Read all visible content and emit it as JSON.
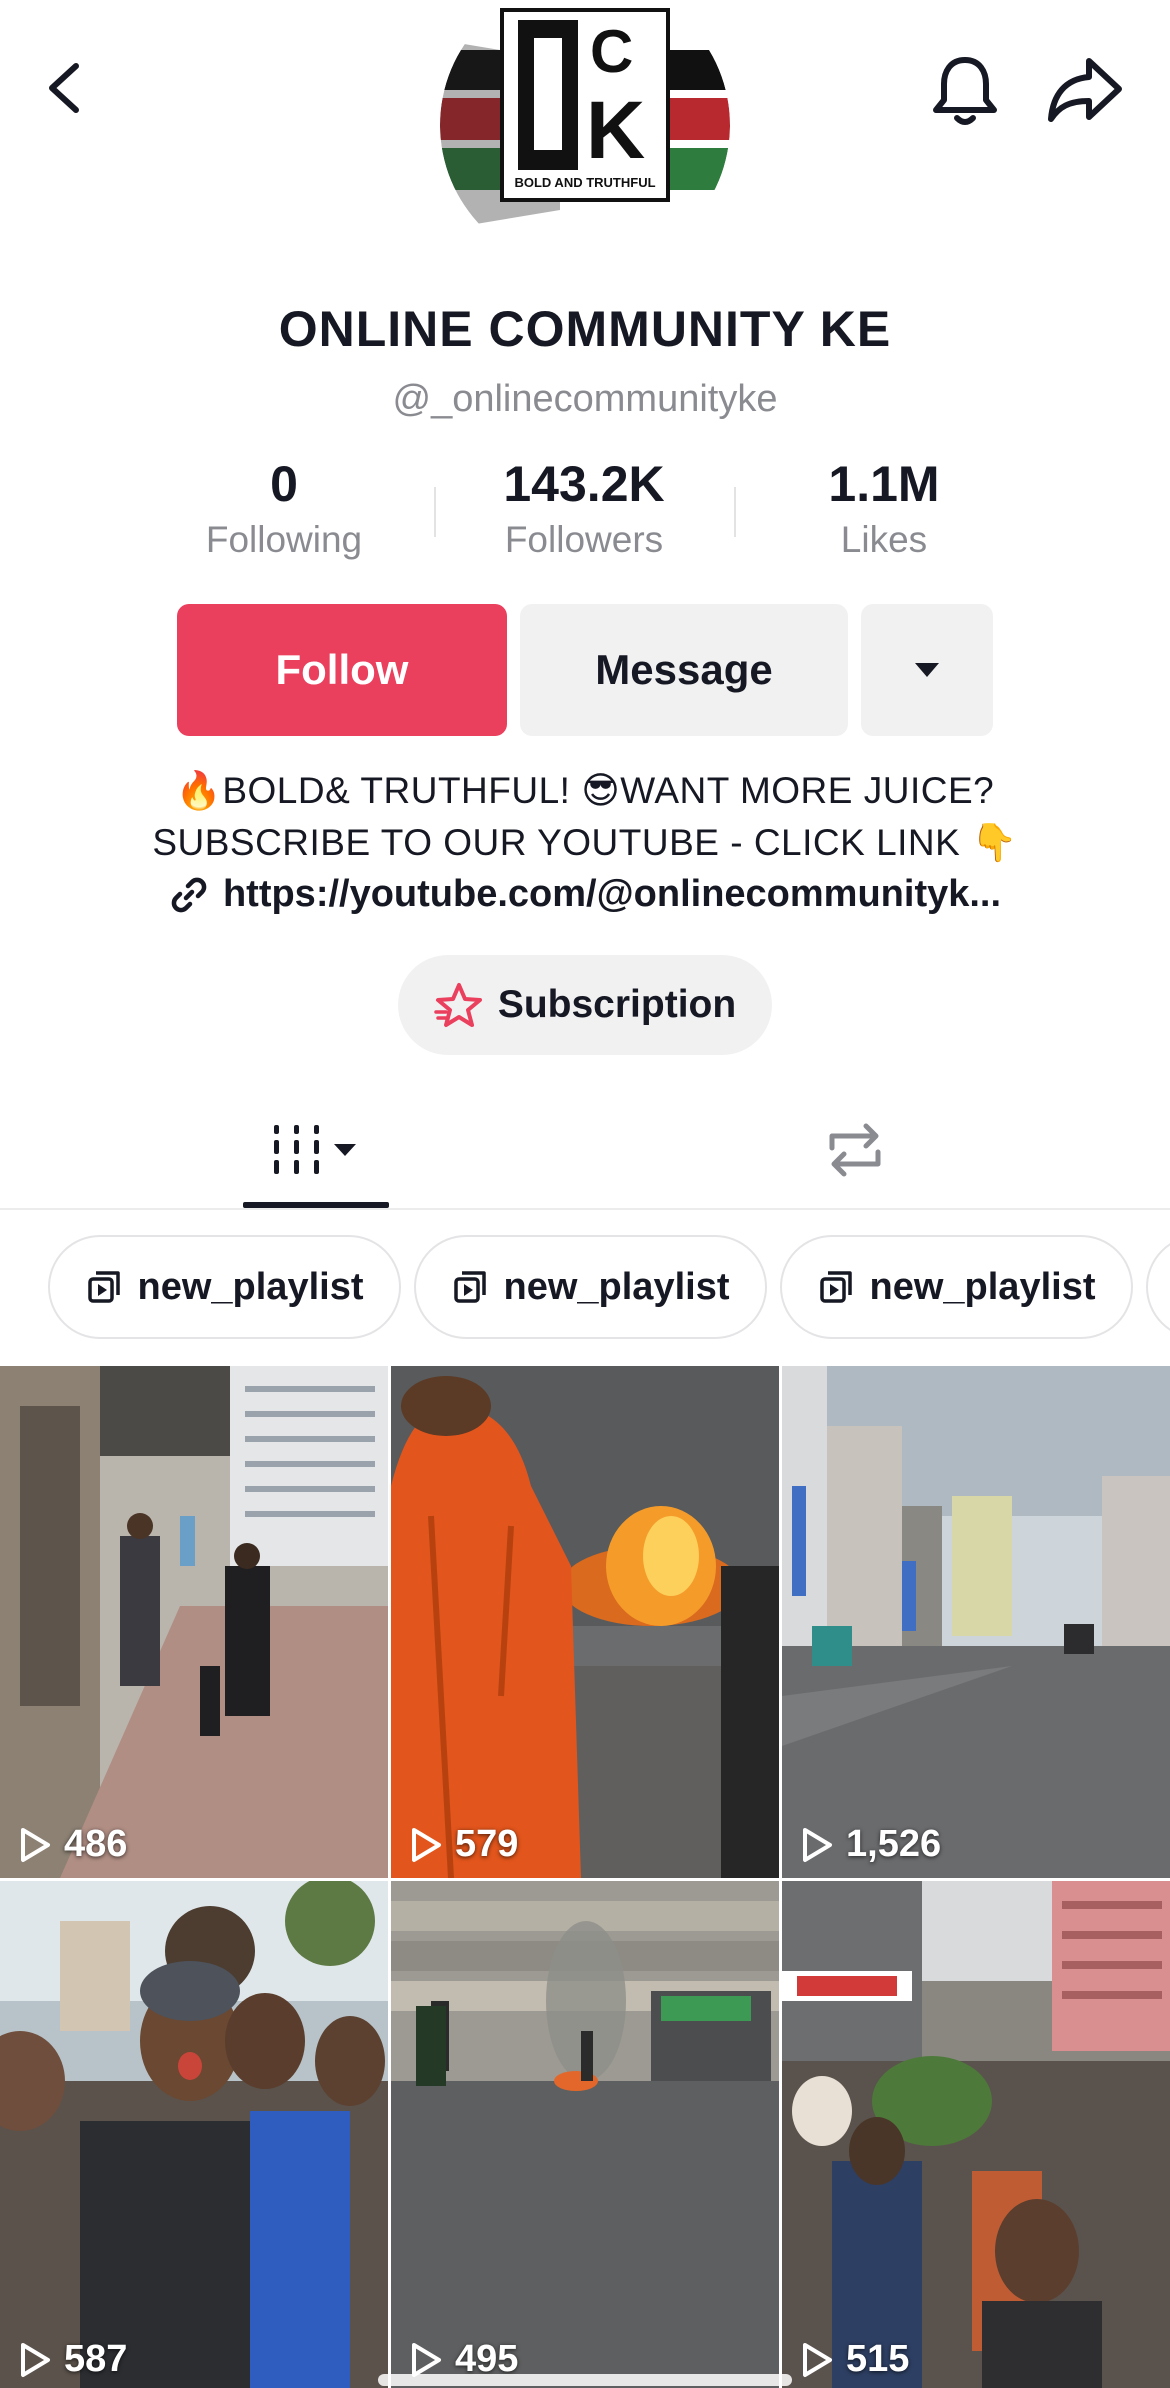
{
  "header": {
    "back_icon": "chevron-left-icon",
    "bell_icon": "bell-icon",
    "share_icon": "share-arrow-icon"
  },
  "avatar": {
    "logo_letters": [
      "O",
      "C",
      "K"
    ],
    "tagline": "BOLD AND TRUTHFUL",
    "colors": {
      "black": "#111111",
      "red": "#b8282f",
      "green": "#2f7d3e"
    }
  },
  "profile": {
    "display_name": "ONLINE COMMUNITY KE",
    "username": "@_onlinecommunityke"
  },
  "stats": [
    {
      "value": "0",
      "label": "Following"
    },
    {
      "value": "143.2K",
      "label": "Followers"
    },
    {
      "value": "1.1M",
      "label": "Likes"
    }
  ],
  "actions": {
    "follow": "Follow",
    "message": "Message",
    "more_icon": "caret-down-icon"
  },
  "bio": {
    "line1": "🔥BOLD& TRUTHFUL! 😎WANT MORE JUICE?",
    "line2": "SUBSCRIBE TO OUR YOUTUBE - CLICK LINK 👇",
    "link": "https://youtube.com/@onlinecommunityk..."
  },
  "subscription": {
    "label": "Subscription",
    "icon": "star-badge-icon"
  },
  "tabs": [
    {
      "name": "videos",
      "icon": "grid-bars-icon",
      "active": true
    },
    {
      "name": "reposts",
      "icon": "repost-icon",
      "active": false
    }
  ],
  "playlists": [
    {
      "label": "new_playlist"
    },
    {
      "label": "new_playlist"
    },
    {
      "label": "new_playlist"
    }
  ],
  "videos": [
    {
      "views": "486"
    },
    {
      "views": "579"
    },
    {
      "views": "1,526"
    },
    {
      "views": "587"
    },
    {
      "views": "495"
    },
    {
      "views": "515"
    }
  ],
  "colors": {
    "accent": "#ea3f5d",
    "muted": "#8a8b91",
    "button_gray": "#f1f1f2"
  }
}
